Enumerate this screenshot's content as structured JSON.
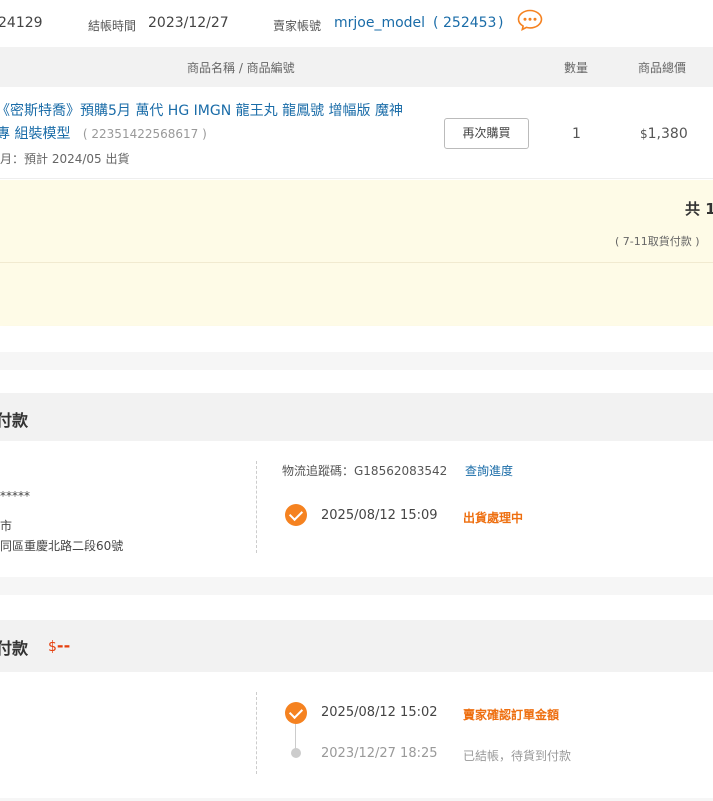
{
  "header": {
    "order_no_fragment": "24129",
    "checkout_time_label": "結帳時間",
    "checkout_time": "2023/12/27",
    "seller_label": "賣家帳號",
    "seller_account": "mrjoe_model",
    "seller_id_open": "(",
    "seller_id": "252453",
    "seller_id_close": ")",
    "chat_icon": "chat-bubble-icon"
  },
  "table_header": {
    "product_col": "商品名稱 / 商品編號",
    "qty_col": "數量",
    "total_col": "商品總價"
  },
  "product": {
    "name_line1": "《密斯特喬》預購5月 萬代 HG IMGN 龍王丸 龍鳳號 增幅版 魔神",
    "name_line2": "專 組裝模型",
    "code": "( 22351422568617 )",
    "ship_note": "月：預計 2024/05 出貨",
    "rebuy_label": "再次購買",
    "qty": "1",
    "price_currency": "$",
    "price": "1,380"
  },
  "summary": {
    "total_fragment": "共 1",
    "payment_method": "( 7-11取貨付款 )"
  },
  "shipping_section": {
    "title": "付款",
    "masked_name": "*****",
    "city": "市",
    "address": "同區重慶北路二段60號",
    "tracking_label": "物流追蹤碼：G18562083542",
    "tracking_link": "查詢進度",
    "event_time": "2025/08/12 15:09",
    "event_status": "出貨處理中"
  },
  "payment_section": {
    "title": "付款",
    "amount_currency": "$",
    "amount": "--",
    "events": [
      {
        "time": "2025/08/12 15:02",
        "status": "賣家確認訂單金額"
      },
      {
        "time": "2023/12/27 18:25",
        "status": "已結帳，待貨到付款"
      }
    ]
  },
  "colors": {
    "accent": "#f58220",
    "link": "#1a6ca8",
    "summary_bg": "#fefbe7",
    "amount_red": "#e5400f"
  }
}
